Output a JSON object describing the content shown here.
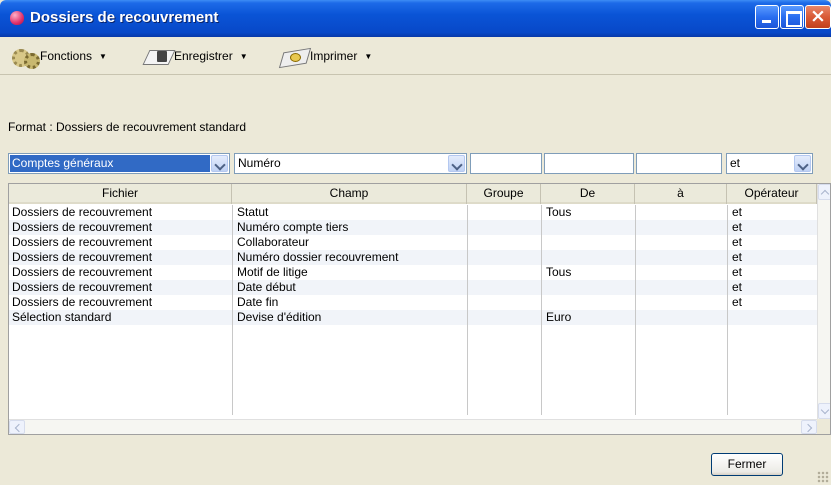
{
  "window": {
    "title": "Dossiers de recouvrement"
  },
  "toolbar": {
    "fonctions_label": "Fonctions",
    "enregistrer_label": "Enregistrer",
    "imprimer_label": "Imprimer"
  },
  "format_line": "Format : Dossiers de recouvrement standard",
  "filter": {
    "fichier_value": "Comptes généraux",
    "champ_value": "Numéro",
    "groupe_value": "",
    "de_value": "",
    "a_value": "",
    "operateur_value": "et"
  },
  "grid": {
    "columns": [
      "Fichier",
      "Champ",
      "Groupe",
      "De",
      "à",
      "Opérateur"
    ],
    "rows": [
      [
        "Dossiers de recouvrement",
        "Statut",
        "",
        "Tous",
        "",
        "et"
      ],
      [
        "Dossiers de recouvrement",
        "Numéro compte tiers",
        "",
        "",
        "",
        "et"
      ],
      [
        "Dossiers de recouvrement",
        "Collaborateur",
        "",
        "",
        "",
        "et"
      ],
      [
        "Dossiers de recouvrement",
        "Numéro dossier recouvrement",
        "",
        "",
        "",
        "et"
      ],
      [
        "Dossiers de recouvrement",
        "Motif de litige",
        "",
        "Tous",
        "",
        "et"
      ],
      [
        "Dossiers de recouvrement",
        "Date début",
        "",
        "",
        "",
        "et"
      ],
      [
        "Dossiers de recouvrement",
        "Date fin",
        "",
        "",
        "",
        "et"
      ],
      [
        "Sélection standard",
        "Devise d'édition",
        "",
        "Euro",
        "",
        ""
      ]
    ]
  },
  "footer": {
    "fermer_label": "Fermer"
  },
  "colors": {
    "titlebar": "#0a54d6",
    "selection": "#316ac5",
    "window_bg": "#ece9d8"
  }
}
